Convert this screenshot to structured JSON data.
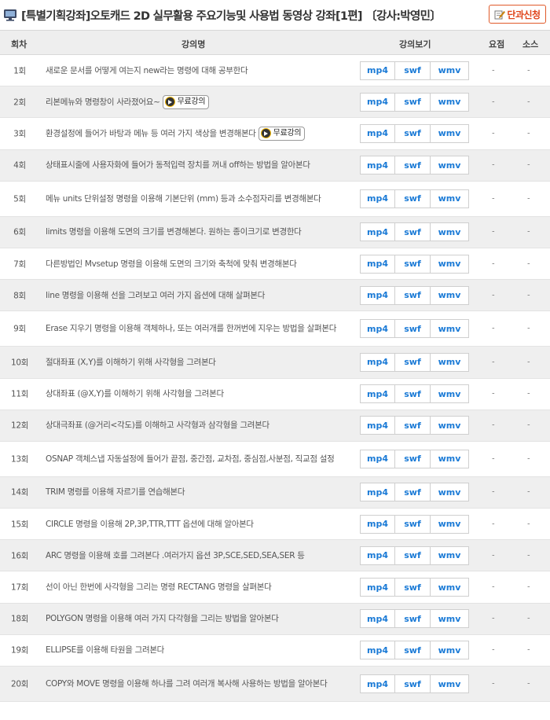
{
  "header": {
    "title": "[특별기획강좌]오토캐드 2D 실무활용 주요기능및 사용법 동영상 강좌[1편]  〔강사:박영민〕",
    "apply_button": "단과신청",
    "accent_color": "#e0441a"
  },
  "columns": {
    "no": "회차",
    "lecture": "강의명",
    "view": "강의보기",
    "summary": "요점",
    "source": "소스"
  },
  "formats": [
    "mp4",
    "swf",
    "wmv"
  ],
  "free_label": "무료강의",
  "rows": [
    {
      "no": "1회",
      "title": "새로운 문서를 어떻게 여는지 new라는 명령에 대해 공부한다",
      "summary": "-",
      "source": "-"
    },
    {
      "no": "2회",
      "title": "리본메뉴와 명령창이 사라졌어요~",
      "free": true,
      "summary": "-",
      "source": "-"
    },
    {
      "no": "3회",
      "title": "환경설정에 들어가 바탕과 메뉴 등 여러 가지 색상을 변경해본다",
      "free": true,
      "summary": "-",
      "source": "-"
    },
    {
      "no": "4회",
      "title": "상태표시줄에 사용자화에 들어가 동적입력 장치를 꺼내 off하는 방법을 알아본다",
      "summary": "-",
      "source": "-"
    },
    {
      "no": "5회",
      "title": "메뉴 units 단위설정 명령을 이용해 기본단위 (mm) 등과 소수점자리를 변경해본다",
      "summary": "-",
      "source": "-"
    },
    {
      "no": "6회",
      "title": "limits 명령을 이용해 도면의 크기를 변경해본다. 원하는 종이크기로 변경한다",
      "summary": "-",
      "source": "-"
    },
    {
      "no": "7회",
      "title": "다른방법인 Mvsetup 명령을 이용해 도면의 크기와 축척에 맞춰 변경해본다",
      "summary": "-",
      "source": "-"
    },
    {
      "no": "8회",
      "title": "line 명령을 이용해 선을 그려보고 여러 가지 옵션에 대해 살펴본다",
      "summary": "-",
      "source": "-"
    },
    {
      "no": "9회",
      "title": "Erase 지우기 명령을 이용해 객체하나, 또는 여러개를 한꺼번에 지우는 방법을 살펴본다",
      "summary": "-",
      "source": "-"
    },
    {
      "no": "10회",
      "title": "절대좌표 (X,Y)를 이해하기 위해 사각형을 그려본다",
      "summary": "-",
      "source": "-"
    },
    {
      "no": "11회",
      "title": "상대좌표 (@X,Y)를 이해하기 위해 사각형을 그려본다",
      "summary": "-",
      "source": "-"
    },
    {
      "no": "12회",
      "title": "상대극좌표 (@거리<각도)를 이해하고 사각형과 삼각형을 그려본다",
      "summary": "-",
      "source": "-"
    },
    {
      "no": "13회",
      "title": "OSNAP 객체스냅 자동설정에 들어가 끝점, 중간점, 교차점, 중심점,사분점, 직교점 설정",
      "summary": "-",
      "source": "-"
    },
    {
      "no": "14회",
      "title": "TRIM 명령를 이용해 자르기를 연습해본다",
      "summary": "-",
      "source": "-"
    },
    {
      "no": "15회",
      "title": "CIRCLE 명령을 이용해 2P,3P,TTR,TTT 옵션에 대해 알아본다",
      "summary": "-",
      "source": "-"
    },
    {
      "no": "16회",
      "title": "ARC 명령을 이용해 호를 그려본다 .여러가지 옵션 3P,SCE,SED,SEA,SER 등",
      "summary": "-",
      "source": "-"
    },
    {
      "no": "17회",
      "title": "선이 아닌 한번에 사각형을 그리는 명령 RECTANG 명령을 살펴본다",
      "summary": "-",
      "source": "-"
    },
    {
      "no": "18회",
      "title": "POLYGON 명령을 이용해 여러 가지 다각형을 그리는 방법을 알아본다",
      "summary": "-",
      "source": "-"
    },
    {
      "no": "19회",
      "title": "ELLIPSE를 이용해 타원을 그려본다",
      "summary": "-",
      "source": "-"
    },
    {
      "no": "20회",
      "title": "COPY와 MOVE 명령을 이용해 하나를 그려 여러개 복사해 사용하는 방법을 알아본다",
      "summary": "-",
      "source": "-"
    }
  ]
}
